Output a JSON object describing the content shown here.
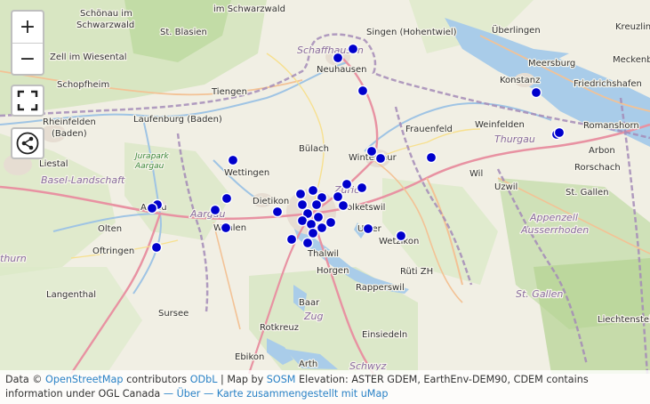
{
  "map": {
    "marker_color": "#0000cc",
    "place_labels": [
      {
        "text": "im Schwarzwald"
      },
      {
        "text": "Schönau im"
      },
      {
        "text": "Schwarzwald"
      },
      {
        "text": "St. Blasien"
      },
      {
        "text": "Zell im Wiesental"
      },
      {
        "text": "Schopfheim"
      },
      {
        "text": "Tiengen"
      },
      {
        "text": "Laufenburg (Baden)"
      },
      {
        "text": "Rheinfelden"
      },
      {
        "text": "(Baden)"
      },
      {
        "text": "Liestal"
      },
      {
        "text": "Basel-Landschaft"
      },
      {
        "text": "Jurapark"
      },
      {
        "text": "Aargau"
      },
      {
        "text": "Wettingen"
      },
      {
        "text": "Aarau"
      },
      {
        "text": "Aargau"
      },
      {
        "text": "Wohlen"
      },
      {
        "text": "Olten"
      },
      {
        "text": "Oftringen"
      },
      {
        "text": "thurn"
      },
      {
        "text": "Langenthal"
      },
      {
        "text": "Sursee"
      },
      {
        "text": "Rotkreuz"
      },
      {
        "text": "Ebikon"
      },
      {
        "text": "Arth"
      },
      {
        "text": "Schwyz"
      },
      {
        "text": "Baar"
      },
      {
        "text": "Zug"
      },
      {
        "text": "Einsiedeln"
      },
      {
        "text": "Horgen"
      },
      {
        "text": "Thalwil"
      },
      {
        "text": "Rapperswil"
      },
      {
        "text": "Rüti ZH"
      },
      {
        "text": "Wetzikon"
      },
      {
        "text": "Uster"
      },
      {
        "text": "Volketswil"
      },
      {
        "text": "Zürich"
      },
      {
        "text": "Dietikon"
      },
      {
        "text": "Bülach"
      },
      {
        "text": "Winterthur"
      },
      {
        "text": "Frauenfeld"
      },
      {
        "text": "Wil"
      },
      {
        "text": "Neuhausen"
      },
      {
        "text": "Schaffhausen"
      },
      {
        "text": "Singen (Hohentwiel)"
      },
      {
        "text": "Überlingen"
      },
      {
        "text": "Meersburg"
      },
      {
        "text": "Meckenbeuren"
      },
      {
        "text": "Konstanz"
      },
      {
        "text": "Friedrichshafen"
      },
      {
        "text": "Weinfelden"
      },
      {
        "text": "Kreuzlingen"
      },
      {
        "text": "Romanshorn"
      },
      {
        "text": "Thurgau"
      },
      {
        "text": "Arbon"
      },
      {
        "text": "Rorschach"
      },
      {
        "text": "Uzwil"
      },
      {
        "text": "St. Gallen"
      },
      {
        "text": "Appenzell"
      },
      {
        "text": "Ausserrhoden"
      },
      {
        "text": "St. Gallen"
      },
      {
        "text": "Liechtenstein"
      }
    ],
    "markers": [
      {
        "near": "Schaffhausen"
      },
      {
        "near": "Schaffhausen 2"
      },
      {
        "near": "Rheinau"
      },
      {
        "near": "Konstanz"
      },
      {
        "near": "Romanshorn"
      },
      {
        "near": "Romanshorn 2"
      },
      {
        "near": "Winterthur"
      },
      {
        "near": "Winterthur 2"
      },
      {
        "near": "Elgg"
      },
      {
        "near": "Wettingen"
      },
      {
        "near": "Aarau"
      },
      {
        "near": "Aarau 2"
      },
      {
        "near": "Lenzburg"
      },
      {
        "near": "Baden"
      },
      {
        "near": "Wohlen"
      },
      {
        "near": "Oftringen"
      },
      {
        "near": "Dietikon"
      },
      {
        "near": "Zürich"
      },
      {
        "near": "Wallisellen"
      },
      {
        "near": "Dübendorf"
      },
      {
        "near": "Volketswil"
      },
      {
        "near": "Effretikon"
      },
      {
        "near": "Uster"
      },
      {
        "near": "Wetzikon"
      },
      {
        "near": "Adliswil"
      },
      {
        "near": "Thalwil"
      }
    ]
  },
  "controls": {
    "zoom_in": "+",
    "zoom_out": "−",
    "fullscreen_icon": "fullscreen-icon",
    "share_icon": "share-icon"
  },
  "attribution": {
    "data_prefix": "Data ©",
    "osm": "OpenStreetMap",
    "contributors": "contributors",
    "odbl": "ODbL",
    "sep1": "| Map by",
    "sosm": "SOSM",
    "elevation": "Elevation: ASTER GDEM, EarthEnv-DEM90, CDEM contains information under OGL Canada",
    "dash1": "—",
    "about": "Über",
    "dash2": "—",
    "umap": "Karte zusammengestellt mit uMap"
  }
}
